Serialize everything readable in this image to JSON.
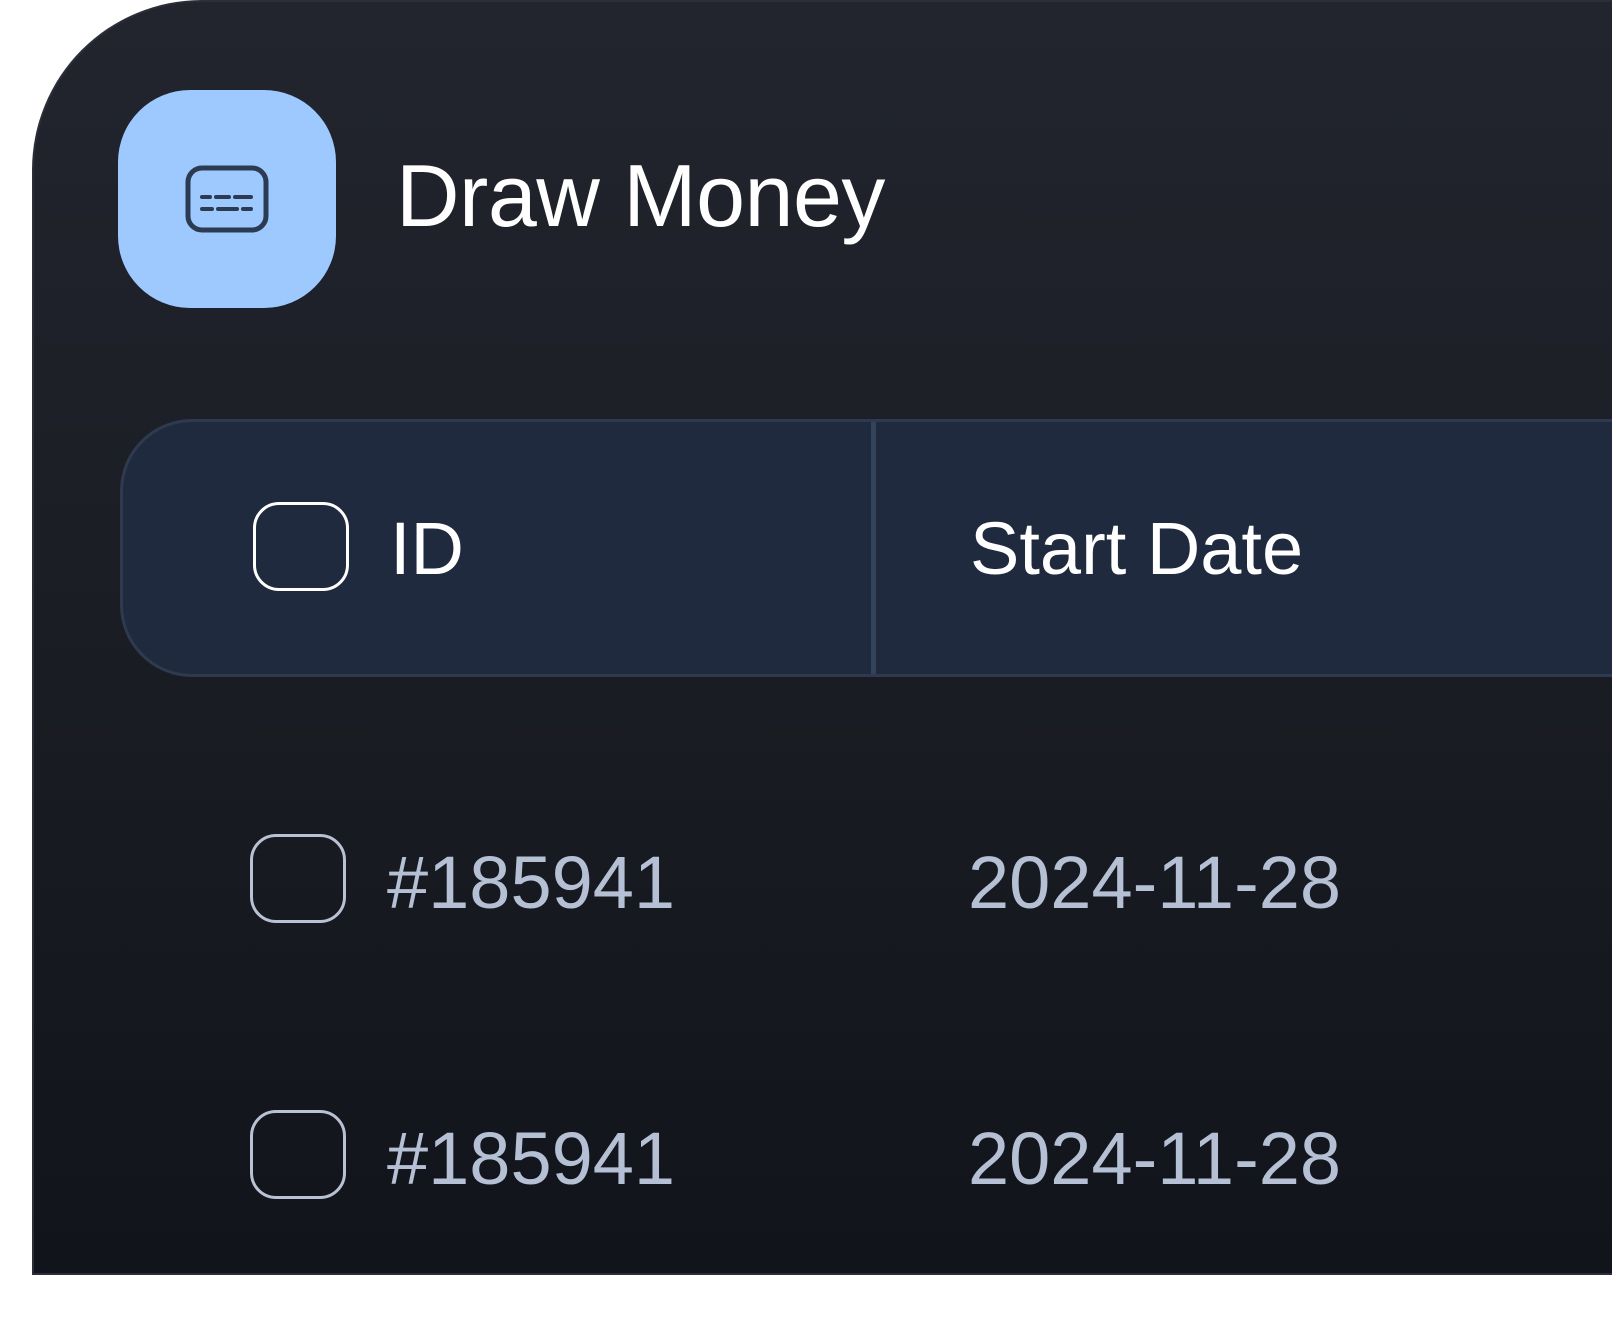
{
  "app": {
    "title": "Draw Money",
    "icon": "keyboard-icon",
    "icon_bg": "#9ec9ff"
  },
  "table": {
    "columns": [
      {
        "label": "ID"
      },
      {
        "label": "Start Date"
      }
    ],
    "rows": [
      {
        "id": "#185941",
        "start_date": "2024-11-28"
      },
      {
        "id": "#185941",
        "start_date": "2024-11-28"
      }
    ]
  },
  "colors": {
    "card_bg": "#1d2027",
    "header_bg": "#1f2a3e",
    "text_primary": "#ffffff",
    "text_secondary": "#b5c0d4"
  }
}
